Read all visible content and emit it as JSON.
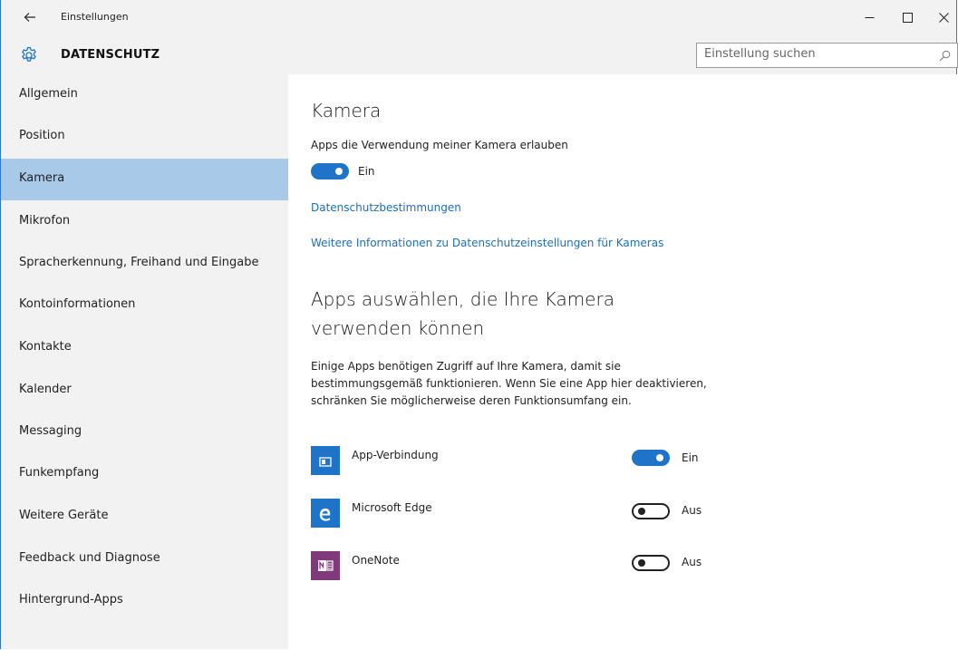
{
  "window": {
    "title": "Einstellungen"
  },
  "header": {
    "title": "DATENSCHUTZ",
    "search_placeholder": "Einstellung suchen"
  },
  "sidebar": {
    "active_index": 2,
    "items": [
      {
        "label": "Allgemein"
      },
      {
        "label": "Position"
      },
      {
        "label": "Kamera"
      },
      {
        "label": "Mikrofon"
      },
      {
        "label": "Spracherkennung, Freihand und Eingabe"
      },
      {
        "label": "Kontoinformationen"
      },
      {
        "label": "Kontakte"
      },
      {
        "label": "Kalender"
      },
      {
        "label": "Messaging"
      },
      {
        "label": "Funkempfang"
      },
      {
        "label": "Weitere Geräte"
      },
      {
        "label": "Feedback und Diagnose"
      },
      {
        "label": "Hintergrund-Apps"
      }
    ]
  },
  "main": {
    "title": "Kamera",
    "master_toggle": {
      "label": "Apps die Verwendung meiner Kamera erlauben",
      "state": "Ein",
      "on": true
    },
    "links": {
      "privacy": "Datenschutzbestimmungen",
      "more_info": "Weitere Informationen zu Datenschutzeinstellungen für Kameras"
    },
    "apps_heading_line1": "Apps auswählen, die Ihre Kamera",
    "apps_heading_line2": "verwenden können",
    "description": "Einige Apps benötigen Zugriff auf Ihre Kamera, damit sie bestimmungsgemäß funktionieren. Wenn Sie eine App hier deaktivieren, schränken Sie möglicherweise deren Funktionsumfang ein.",
    "apps": [
      {
        "name": "App-Verbindung",
        "state": "Ein",
        "on": true,
        "icon": "app-connector-icon",
        "color": "#1f73c8"
      },
      {
        "name": "Microsoft Edge",
        "state": "Aus",
        "on": false,
        "icon": "edge-icon",
        "color": "#1f73c8"
      },
      {
        "name": "OneNote",
        "state": "Aus",
        "on": false,
        "icon": "onenote-icon",
        "color": "#80397b"
      }
    ]
  },
  "colors": {
    "accent": "#1f73c8",
    "selection": "#a8c9e8",
    "link": "#1a6fbf"
  }
}
